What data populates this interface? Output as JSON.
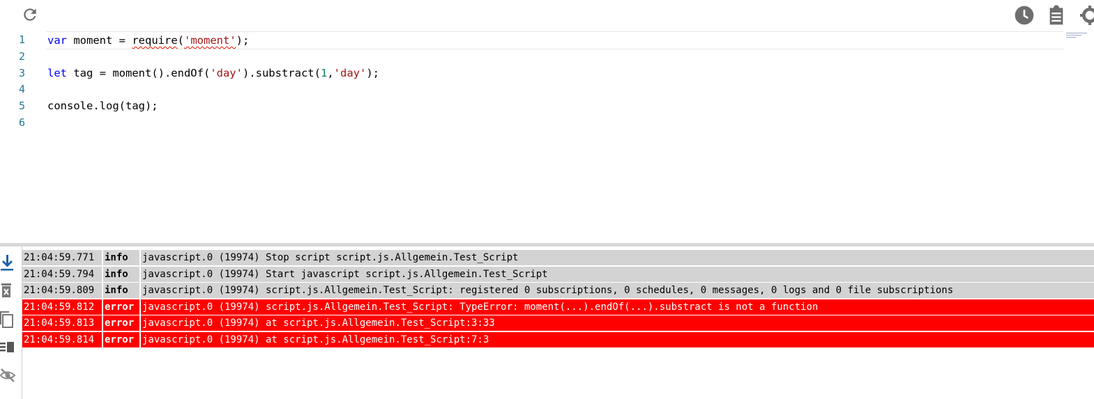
{
  "toolbar": {
    "reload_icon": "reload-icon",
    "right_icons": [
      "clock-icon",
      "clipboard-icon",
      "gear-icon"
    ]
  },
  "editor": {
    "lines": [
      {
        "num": "1",
        "tokens": [
          {
            "t": "var",
            "c": "kw"
          },
          {
            "t": " moment = "
          },
          {
            "t": "require",
            "c": "squiggle"
          },
          {
            "t": "("
          },
          {
            "t": "'moment'",
            "c": "str squiggle"
          },
          {
            "t": ");"
          }
        ]
      },
      {
        "num": "2",
        "tokens": []
      },
      {
        "num": "3",
        "tokens": [
          {
            "t": "let",
            "c": "kw"
          },
          {
            "t": " tag = moment().endOf("
          },
          {
            "t": "'day'",
            "c": "str"
          },
          {
            "t": ").substract("
          },
          {
            "t": "1",
            "c": "num"
          },
          {
            "t": ","
          },
          {
            "t": "'day'",
            "c": "str"
          },
          {
            "t": ");"
          }
        ]
      },
      {
        "num": "4",
        "tokens": []
      },
      {
        "num": "5",
        "tokens": [
          {
            "t": "console.log(tag);"
          }
        ]
      },
      {
        "num": "6",
        "tokens": []
      }
    ]
  },
  "log": {
    "toolbar_icons": [
      "scroll-down-icon",
      "clear-log-icon",
      "copy-icon",
      "columns-icon",
      "hide-icon"
    ],
    "rows": [
      {
        "time": "21:04:59.771",
        "severity": "info",
        "message": "javascript.0 (19974) Stop script script.js.Allgemein.Test_Script"
      },
      {
        "time": "21:04:59.794",
        "severity": "info",
        "message": "javascript.0 (19974) Start javascript script.js.Allgemein.Test_Script"
      },
      {
        "time": "21:04:59.809",
        "severity": "info",
        "message": "javascript.0 (19974) script.js.Allgemein.Test_Script: registered 0 subscriptions, 0 schedules, 0 messages, 0 logs and 0 file subscriptions"
      },
      {
        "time": "21:04:59.812",
        "severity": "error",
        "message": "javascript.0 (19974) script.js.Allgemein.Test_Script: TypeError: moment(...).endOf(...).substract is not a function"
      },
      {
        "time": "21:04:59.813",
        "severity": "error",
        "message": "javascript.0 (19974) at script.js.Allgemein.Test_Script:3:33"
      },
      {
        "time": "21:04:59.814",
        "severity": "error",
        "message": "javascript.0 (19974) at script.js.Allgemein.Test_Script:7:3"
      }
    ]
  },
  "colors": {
    "error_bg": "#ff0000",
    "info_bg": "#d3d3d3",
    "icon": "#5f6368"
  }
}
